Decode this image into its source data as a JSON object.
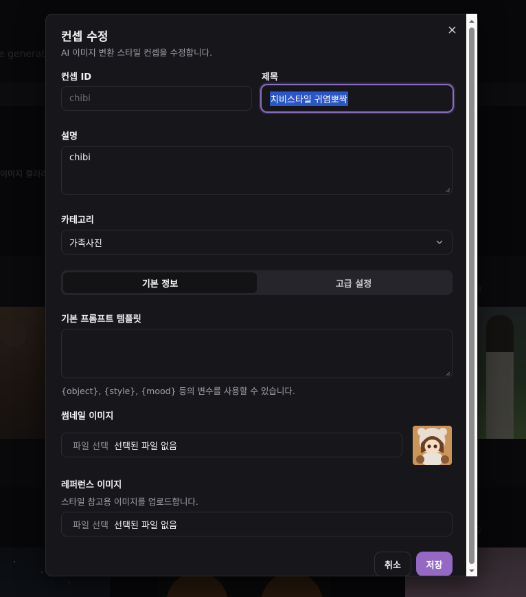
{
  "background": {
    "subtitle_partial": "e generat",
    "gallery_tab_partial": "이미지 갤러리",
    "faint_label_1": "3",
    "faint_label_2": "2"
  },
  "modal": {
    "title": "컨셉 수정",
    "description": "AI 이미지 변환 스타일 컨셉을 수정합니다.",
    "close_icon": "close-icon"
  },
  "form": {
    "concept_id": {
      "label": "컨셉 ID",
      "value": "chibi"
    },
    "title": {
      "label": "제목",
      "value": "치비스타일 귀염뽀짝"
    },
    "description": {
      "label": "설명",
      "value": "chibi"
    },
    "category": {
      "label": "카테고리",
      "value": "가족사진"
    },
    "tabs": [
      {
        "label": "기본 정보",
        "active": true
      },
      {
        "label": "고급 설정",
        "active": false
      }
    ],
    "prompt_template": {
      "label": "기본 프롬프트 템플릿",
      "value": "",
      "helper": "{object}, {style}, {mood} 등의 변수를 사용할 수 있습니다."
    },
    "thumbnail": {
      "label": "썸네일 이미지",
      "button": "파일 선택",
      "status": "선택된 파일 없음"
    },
    "reference": {
      "label": "레퍼런스 이미지",
      "helper": "스타일 참고용 이미지를 업로드합니다.",
      "button": "파일 선택",
      "status": "선택된 파일 없음"
    }
  },
  "footer": {
    "cancel": "취소",
    "save": "저장"
  },
  "colors": {
    "accent": "#9468c4",
    "focus_ring": "#8b6dc4",
    "surface": "#17171b",
    "text_selection": "#2b56c8"
  }
}
